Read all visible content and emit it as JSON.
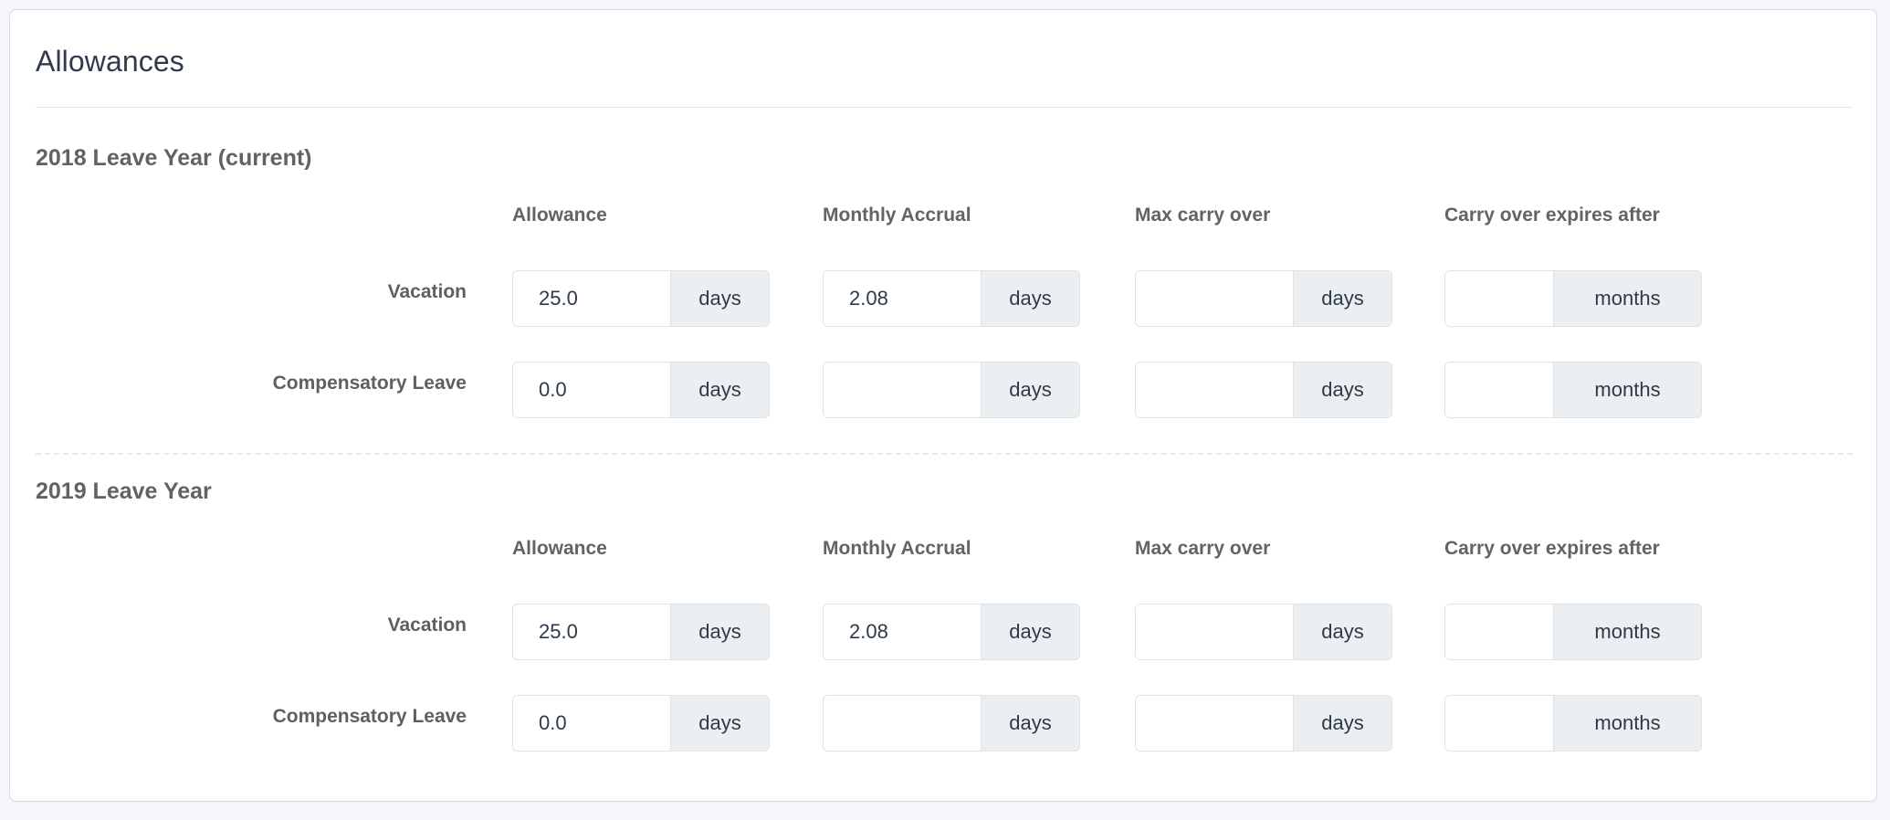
{
  "card": {
    "title": "Allowances"
  },
  "columns": [
    {
      "label": "Allowance",
      "unit": "days"
    },
    {
      "label": "Monthly Accrual",
      "unit": "days"
    },
    {
      "label": "Max carry over",
      "unit": "days"
    },
    {
      "label": "Carry over expires after",
      "unit": "months"
    }
  ],
  "sections": [
    {
      "heading": "2018 Leave Year (current)",
      "rows": [
        {
          "label": "Vacation",
          "values": [
            "25.0",
            "2.08",
            "",
            ""
          ]
        },
        {
          "label": "Compensatory Leave",
          "values": [
            "0.0",
            "",
            "",
            ""
          ]
        }
      ]
    },
    {
      "heading": "2019 Leave Year",
      "rows": [
        {
          "label": "Vacation",
          "values": [
            "25.0",
            "2.08",
            "",
            ""
          ]
        },
        {
          "label": "Compensatory Leave",
          "values": [
            "0.0",
            "",
            "",
            ""
          ]
        }
      ]
    }
  ],
  "colors": {
    "card_border": "#d3dce2",
    "page_background": "#f4f6f9",
    "addon_background": "#eceff1",
    "title_text": "#2f3b4d",
    "label_text": "#5f5f5f"
  }
}
